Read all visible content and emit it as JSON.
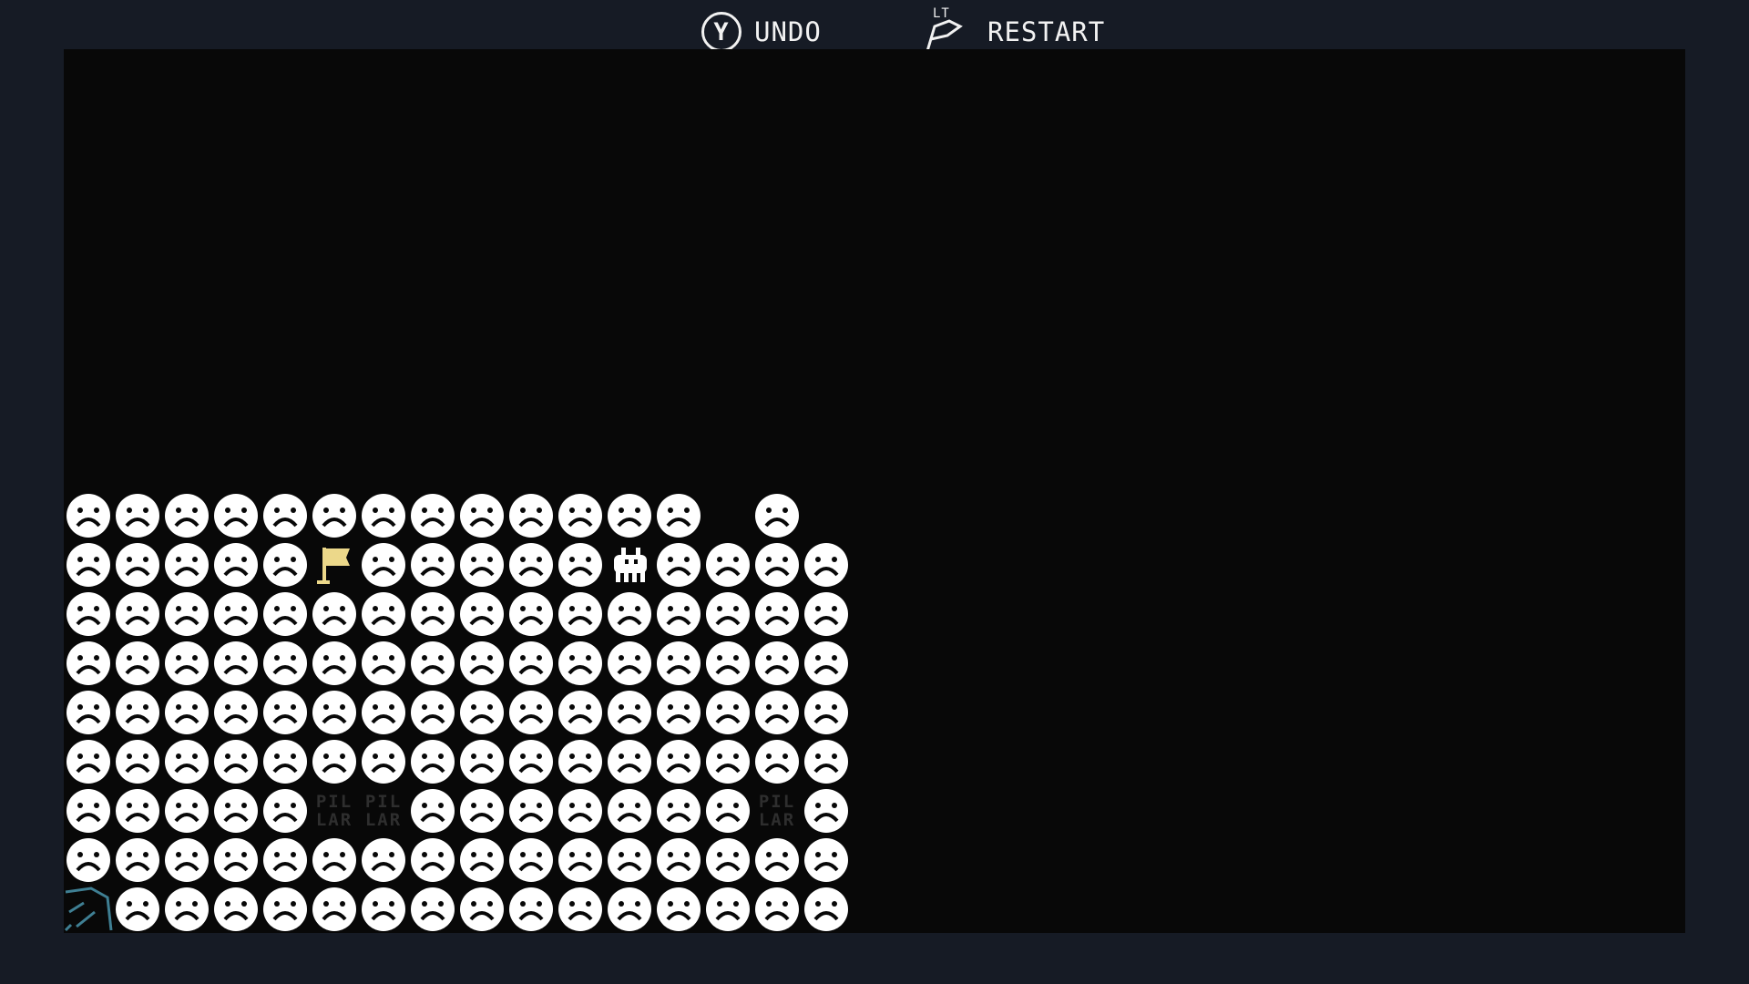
{
  "hud": {
    "undo": {
      "button": "Y",
      "label": "UNDO",
      "icon": "y-button-icon"
    },
    "restart": {
      "button": "LT",
      "label": "RESTART",
      "icon": "lt-trigger-icon"
    }
  },
  "board": {
    "columns": 16,
    "rows": 9,
    "legend": {
      "s": "skull-icon",
      "_": "empty",
      "f": "flag-icon",
      "b": "baba-icon",
      "p": "pillar-word",
      "w": "water-icon"
    },
    "grid": [
      "sssssssssssss_s_",
      "sssssfsssssbssss",
      "ssssssssssssssss",
      "ssssssssssssssss",
      "ssssssssssssssss",
      "ssssssssssssssss",
      "sssssppssssssspss",
      "ssssssssssssssss",
      "wsssssssssssssss"
    ],
    "pillar_text": [
      "PIL",
      "LAR"
    ],
    "colors": {
      "skull": "#ffffff",
      "flag": "#ecd88a",
      "baba": "#ffffff",
      "pillar_text": "#2e2e2e",
      "water": "#3f7f93",
      "game_bg": "#080808",
      "frame_bg": "#161b25"
    }
  }
}
